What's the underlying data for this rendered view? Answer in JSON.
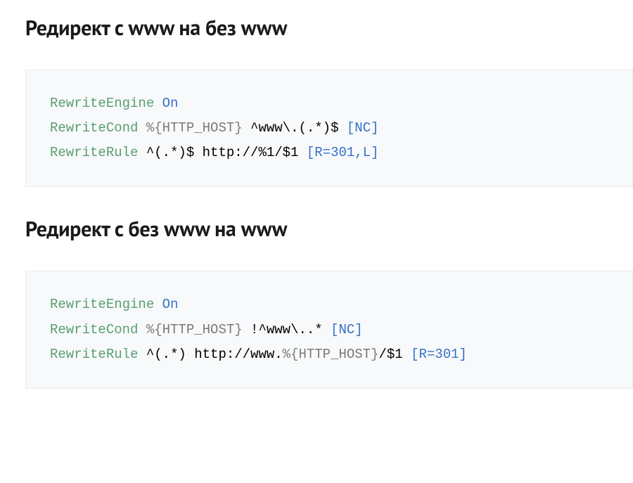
{
  "sections": [
    {
      "heading": "Редирект с www на без www",
      "code": {
        "lines": [
          {
            "tokens": [
              {
                "text": "RewriteEngine",
                "cls": "tok-green"
              },
              {
                "text": " ",
                "cls": ""
              },
              {
                "text": "On",
                "cls": "tok-blue"
              }
            ]
          },
          {
            "tokens": [
              {
                "text": "RewriteCond",
                "cls": "tok-green"
              },
              {
                "text": " ",
                "cls": ""
              },
              {
                "text": "%{HTTP_HOST}",
                "cls": "tok-gray"
              },
              {
                "text": " ^www\\.(.*)$ ",
                "cls": ""
              },
              {
                "text": "[NC]",
                "cls": "tok-darkblue"
              }
            ]
          },
          {
            "tokens": [
              {
                "text": "RewriteRule",
                "cls": "tok-green"
              },
              {
                "text": " ^(.*)$ http://%1/$1 ",
                "cls": ""
              },
              {
                "text": "[R=301,L]",
                "cls": "tok-darkblue"
              }
            ]
          }
        ]
      }
    },
    {
      "heading": "Редирект с без www на www",
      "code": {
        "lines": [
          {
            "tokens": [
              {
                "text": "RewriteEngine",
                "cls": "tok-green"
              },
              {
                "text": " ",
                "cls": ""
              },
              {
                "text": "On",
                "cls": "tok-blue"
              }
            ]
          },
          {
            "tokens": [
              {
                "text": "RewriteCond",
                "cls": "tok-green"
              },
              {
                "text": " ",
                "cls": ""
              },
              {
                "text": "%{HTTP_HOST}",
                "cls": "tok-gray"
              },
              {
                "text": " !^www\\..* ",
                "cls": ""
              },
              {
                "text": "[NC]",
                "cls": "tok-darkblue"
              }
            ]
          },
          {
            "tokens": [
              {
                "text": "RewriteRule",
                "cls": "tok-green"
              },
              {
                "text": " ^(.*) http://www.",
                "cls": ""
              },
              {
                "text": "%{HTTP_HOST}",
                "cls": "tok-gray"
              },
              {
                "text": "/$1 ",
                "cls": ""
              },
              {
                "text": "[R=301]",
                "cls": "tok-darkblue"
              }
            ]
          }
        ]
      }
    }
  ]
}
